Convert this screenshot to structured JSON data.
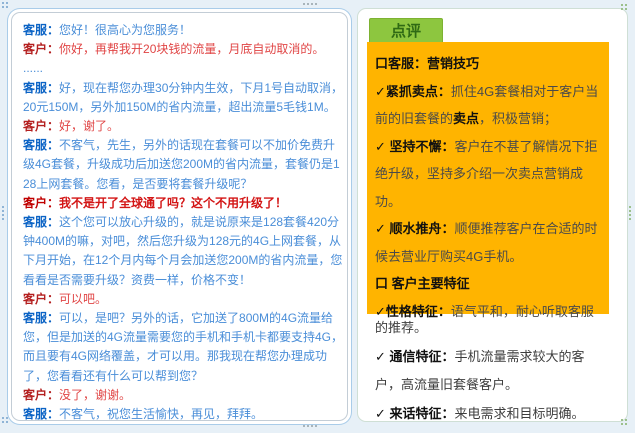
{
  "dialogue": {
    "rows": [
      {
        "label": "客服：",
        "text": "您好！很高心为您服务！"
      },
      {
        "label": "客户：",
        "text": "你好，再帮我开20块钱的流量，月底自动取消的。"
      },
      {
        "label": "",
        "text": "......"
      },
      {
        "label": "客服：",
        "text": "好，现在帮您办理30分钟内生效，下月1号自动取消，20元150M，另外加150M的省内流量，超出流量5毛钱1M。"
      },
      {
        "label": "客户：",
        "text": "好，谢了。"
      },
      {
        "label": "客服：",
        "text": "不客气，先生，另外的话现在套餐可以不加价免费升级4G套餐，升级成功后加送您200M的省内流量，套餐仍是128上网套餐。您看，是否要将套餐升级呢？"
      },
      {
        "label": "客户：",
        "text": "我不是开了全球通了吗？这个不用升级了！"
      },
      {
        "label": "客服：",
        "text": "这个您可以放心升级的，就是说原来是128套餐420分钟400M的嘛，对吧，然后您升级为128元的4G上网套餐，从下月开始，在12个月内每个月会加送您200M的省内流量，您看看是否需要升级？资费一样，价格不变！"
      },
      {
        "label": "客户：",
        "text": "可以吧。"
      },
      {
        "label": "客服：",
        "text": "可以，是吧？另外的话，它加送了800M的4G流量给您，但是加送的4G流量需要您的手机和手机卡都要支持4G，而且要有4G网络覆盖，才可以用。那我现在帮您办理成功了，您看看还有什么可以帮到您？"
      },
      {
        "label": "客户：",
        "text": "没了，谢谢。"
      },
      {
        "label": "客服：",
        "text": "不客气，祝您生活愉快，再见，拜拜。"
      }
    ]
  },
  "review": {
    "badge": "点评",
    "section1_title": "口客服：营销技巧",
    "item1": {
      "check": "✓",
      "label": "紧抓卖点：",
      "t1": "抓住4G套餐相对于客户当前的旧套餐的",
      "b": "卖点",
      "t2": "，积极营销；"
    },
    "item2": {
      "check": "✓ ",
      "label": "坚持不懈：",
      "t1": "客户在不甚了解情况下拒绝升级，坚持多介绍一次卖点营销成功。"
    },
    "item3": {
      "check": "✓ ",
      "label": "顺水推舟：",
      "t1": "顺便推荐客户在合适的时候去营业厅购买4G手机。"
    },
    "section2_title": "口 客户主要特征",
    "item4": {
      "check": "✓",
      "label": "性格特征：",
      "t1": "语气平和，耐心听取客服"
    },
    "overflow_text": "的推荐。",
    "item5": {
      "check": "✓ ",
      "label": "通信特征：",
      "t1": "手机流量需求较大的客户，高流量旧套餐客户。"
    },
    "item6": {
      "check": "✓ ",
      "label": "来话特征：",
      "t1": "来电需求和目标明确。"
    }
  },
  "colors": {
    "orange_box": "#ffb400",
    "badge_green": "#8dc63f",
    "agent_label_blue": "#0b63c5",
    "agent_text_blue": "#4a8ed8",
    "customer_label_red": "#b42020",
    "customer_text_red": "#e04545",
    "left_card_ring_blue": "#a9cce9",
    "right_card_border_green": "#cfdfd5"
  }
}
